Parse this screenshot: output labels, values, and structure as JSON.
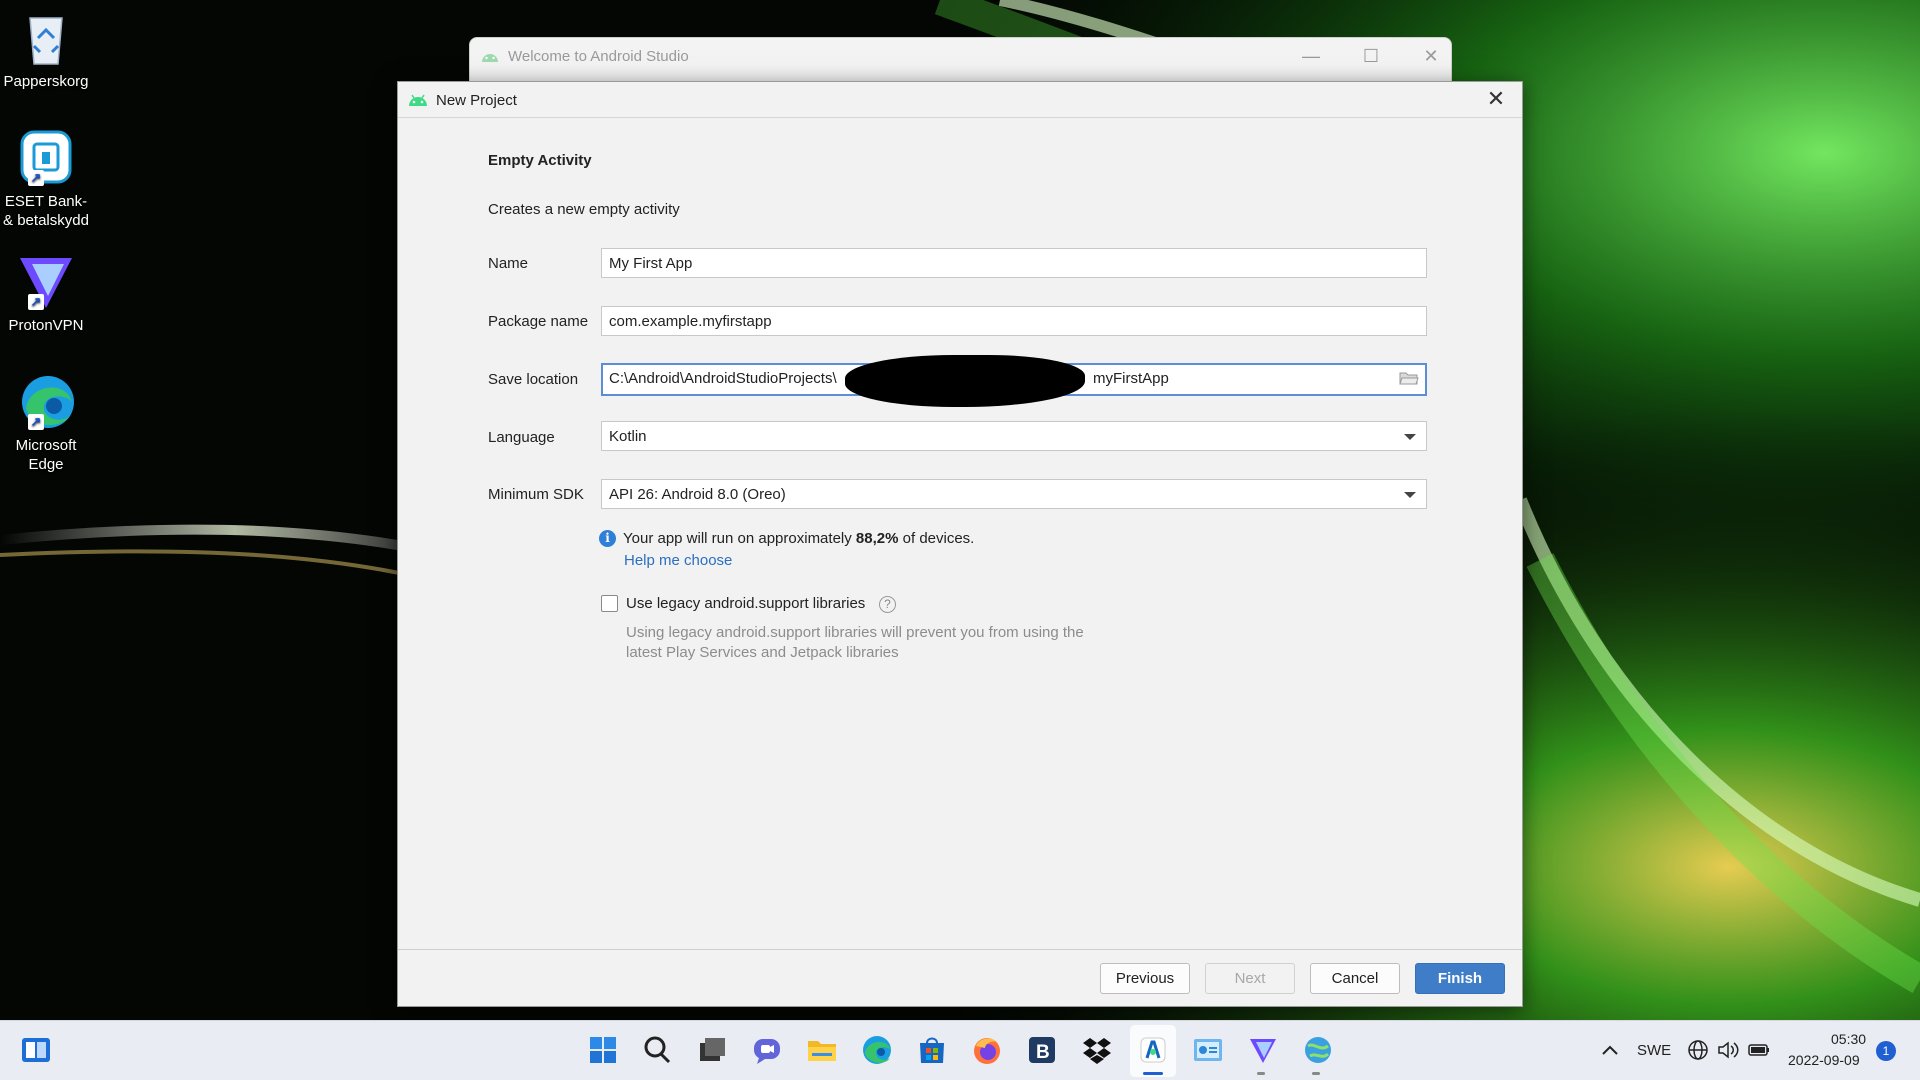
{
  "colors": {
    "accent": "#3f7dc9",
    "link": "#2a6fc0",
    "info": "#2f7fd6",
    "focus_border": "#5a8fd4",
    "android_green": "#3ddc84"
  },
  "desktop": {
    "icons": [
      {
        "label": "Papperskorg",
        "icon": "recycle-bin-icon"
      },
      {
        "label": "ESET Bank- & betalskydd",
        "icon": "eset-icon"
      },
      {
        "label": "ProtonVPN",
        "icon": "protonvpn-icon"
      },
      {
        "label": "Microsoft Edge",
        "icon": "edge-icon"
      }
    ]
  },
  "background_window": {
    "title": "Welcome to Android Studio",
    "controls": {
      "minimize": "—",
      "maximize": "☐",
      "close": "✕"
    }
  },
  "dialog": {
    "title": "New Project",
    "close": "✕",
    "heading": "Empty Activity",
    "description": "Creates a new empty activity",
    "fields": {
      "name": {
        "label": "Name",
        "value": "My First App"
      },
      "package": {
        "label": "Package name",
        "value": "com.example.myfirstapp"
      },
      "save_location": {
        "label": "Save location",
        "value_prefix": "C:\\Android\\AndroidStudioProjects\\",
        "value_suffix": "myFirstApp"
      },
      "language": {
        "label": "Language",
        "value": "Kotlin"
      },
      "min_sdk": {
        "label": "Minimum SDK",
        "value": "API 26: Android 8.0 (Oreo)"
      }
    },
    "info": {
      "prefix": "Your app will run on approximately ",
      "percent": "88,2%",
      "suffix": " of devices.",
      "help_link": "Help me choose"
    },
    "legacy": {
      "checked": false,
      "label": "Use legacy android.support libraries",
      "hint": "Using legacy android.support libraries will prevent you from using the latest Play Services and Jetpack libraries"
    },
    "buttons": {
      "previous": "Previous",
      "next": "Next",
      "cancel": "Cancel",
      "finish": "Finish"
    }
  },
  "taskbar": {
    "apps": [
      "start-icon",
      "search-icon",
      "task-view-icon",
      "chat-icon",
      "file-explorer-icon",
      "edge-icon",
      "store-icon",
      "firefox-icon",
      "b-app-icon",
      "dropbox-icon",
      "android-studio-icon",
      "control-panel-icon",
      "protonvpn-icon",
      "network-tool-icon"
    ],
    "tray": {
      "language": "SWE",
      "time": "05:30",
      "date": "2022-09-09",
      "notifications": "1"
    }
  }
}
